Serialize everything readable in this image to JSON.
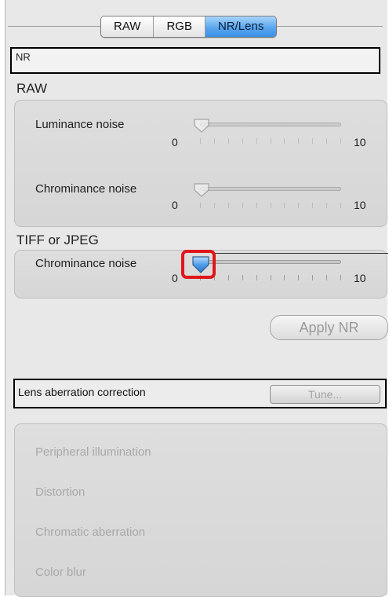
{
  "tabs": [
    {
      "label": "RAW",
      "active": false
    },
    {
      "label": "RGB",
      "active": false
    },
    {
      "label": "NR/Lens",
      "active": true
    }
  ],
  "nr_section": {
    "title": "NR"
  },
  "raw_section": {
    "title": "RAW",
    "sliders": [
      {
        "label": "Luminance noise",
        "min": "0",
        "max": "10",
        "value": 0
      },
      {
        "label": "Chrominance noise",
        "min": "0",
        "max": "10",
        "value": 0
      }
    ]
  },
  "tiff_section": {
    "title": "TIFF or JPEG",
    "slider": {
      "label": "Chrominance noise",
      "min": "0",
      "max": "10",
      "value": 0,
      "highlighted": true
    }
  },
  "apply_nr_label": "Apply NR",
  "lens_section": {
    "title": "Lens aberration correction",
    "tune_label": "Tune...",
    "items": [
      "Peripheral illumination",
      "Distortion",
      "Chromatic aberration",
      "Color blur"
    ]
  },
  "colors": {
    "active_tab": "#5aa7ee",
    "highlight": "#e0161b",
    "panel_bg": "#e8e8e8"
  }
}
